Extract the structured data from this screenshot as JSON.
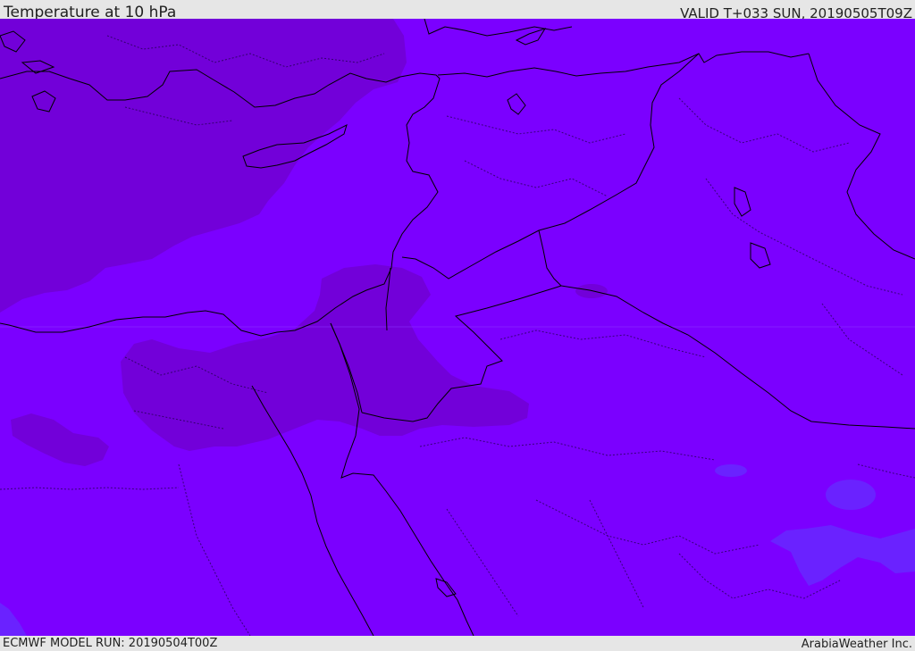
{
  "header": {
    "title": "Temperature at 10 hPa",
    "valid_time": "VALID T+033 SUN, 20190505T09Z"
  },
  "footer": {
    "model_run": "ECMWF MODEL RUN: 20190504T00Z",
    "credit": "ArabiaWeather Inc."
  },
  "colors": {
    "background_field": "#7b00ff",
    "warmer_field": "#7200d9",
    "cooler_field": "#6a22ff",
    "borders": "#000000",
    "frame": "#e6e6e6"
  }
}
